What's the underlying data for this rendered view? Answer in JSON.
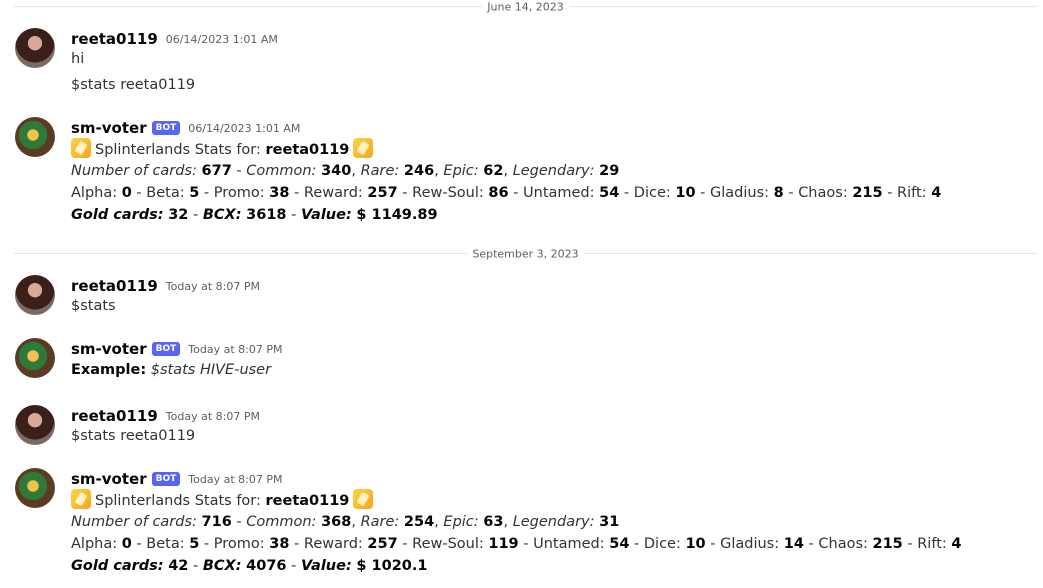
{
  "dividers": {
    "first": "June 14, 2023",
    "second": "September 3, 2023"
  },
  "messages": [
    {
      "username": "reeta0119",
      "timestamp": "06/14/2023 1:01 AM",
      "lines": [
        "hi",
        "$stats reeta0119"
      ]
    },
    {
      "username": "sm-voter",
      "bot_tag": "BOT",
      "timestamp": "06/14/2023 1:01 AM",
      "title_text": "Splinterlands Stats for:",
      "title_user": "reeta0119",
      "cards": {
        "number_label": "Number of cards:",
        "number": "677",
        "common_label": "Common:",
        "common": "340",
        "rare_label": "Rare:",
        "rare": "246",
        "epic_label": "Epic:",
        "epic": "62",
        "legendary_label": "Legendary:",
        "legendary": "29"
      },
      "editions": {
        "alpha": "0",
        "beta": "5",
        "promo": "38",
        "reward": "257",
        "rewsoul": "86",
        "untamed": "54",
        "dice": "10",
        "gladius": "8",
        "chaos": "215",
        "rift": "4"
      },
      "gold": {
        "gold_label": "Gold cards:",
        "gold": "32",
        "bcx_label": "BCX:",
        "bcx": "3618",
        "value_label": "Value:",
        "value": "$ 1149.89"
      }
    },
    {
      "username": "reeta0119",
      "timestamp": "Today at 8:07 PM",
      "lines": [
        "$stats"
      ]
    },
    {
      "username": "sm-voter",
      "bot_tag": "BOT",
      "timestamp": "Today at 8:07 PM",
      "example_label": "Example:",
      "example_text": "$stats HIVE-user"
    },
    {
      "username": "reeta0119",
      "timestamp": "Today at 8:07 PM",
      "lines": [
        "$stats reeta0119"
      ]
    },
    {
      "username": "sm-voter",
      "bot_tag": "BOT",
      "timestamp": "Today at 8:07 PM",
      "title_text": "Splinterlands Stats for:",
      "title_user": "reeta0119",
      "cards": {
        "number_label": "Number of cards:",
        "number": "716",
        "common_label": "Common:",
        "common": "368",
        "rare_label": "Rare:",
        "rare": "254",
        "epic_label": "Epic:",
        "epic": "63",
        "legendary_label": "Legendary:",
        "legendary": "31"
      },
      "editions": {
        "alpha": "0",
        "beta": "5",
        "promo": "38",
        "reward": "257",
        "rewsoul": "119",
        "untamed": "54",
        "dice": "10",
        "gladius": "14",
        "chaos": "215",
        "rift": "4"
      },
      "gold": {
        "gold_label": "Gold cards:",
        "gold": "42",
        "bcx_label": "BCX:",
        "bcx": "4076",
        "value_label": "Value:",
        "value": "$ 1020.1"
      }
    }
  ],
  "edition_labels": {
    "alpha": "Alpha:",
    "beta": "Beta:",
    "promo": "Promo:",
    "reward": "Reward:",
    "rewsoul": "Rew-Soul:",
    "untamed": "Untamed:",
    "dice": "Dice:",
    "gladius": "Gladius:",
    "chaos": "Chaos:",
    "rift": "Rift:"
  },
  "separators": {
    "dash": " - ",
    "comma": ", "
  },
  "icons": {
    "user_avatar": "avatar",
    "bot_avatar": "bot-avatar",
    "emoji": "splinterlands-emoji-icon"
  }
}
